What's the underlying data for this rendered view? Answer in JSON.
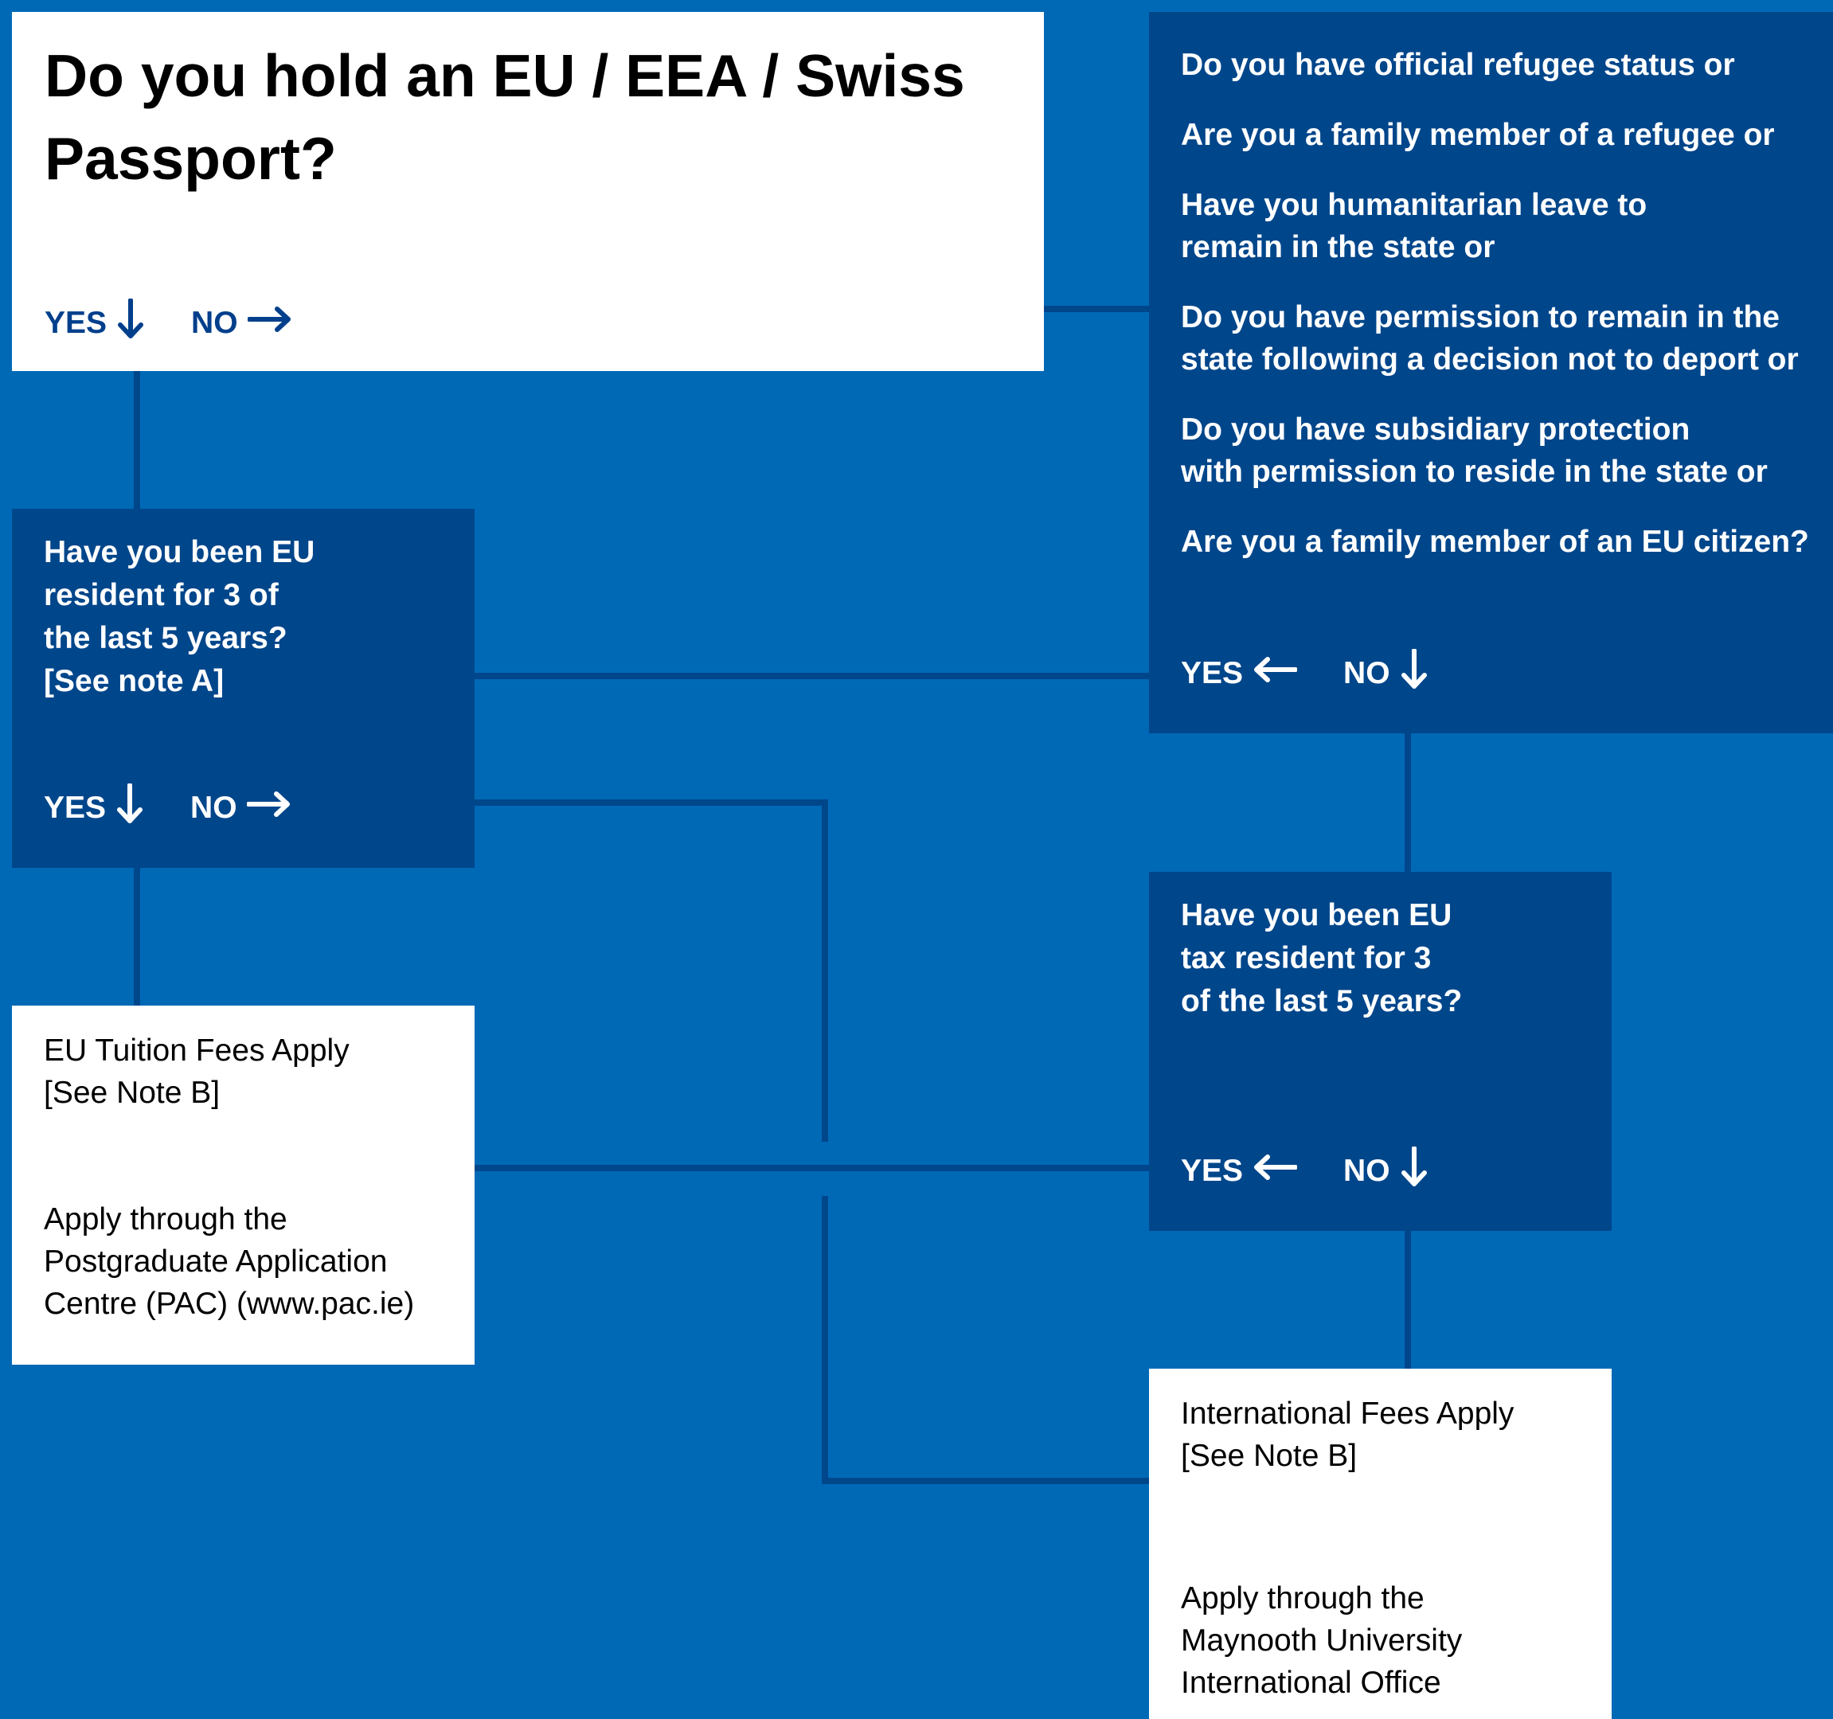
{
  "colors": {
    "background": "#0069B6",
    "dark_box": "#00468B",
    "white_box": "#FFFFFF",
    "connector": "#00468B",
    "yes_no_on_white": "#003F8C"
  },
  "q_passport": {
    "title": "Do you hold an EU / EEA / Swiss Passport?",
    "yes": "YES",
    "no": "NO",
    "yes_arrow": "arrow-down-icon",
    "no_arrow": "arrow-right-icon"
  },
  "q_status": {
    "items": [
      "Do you have official refugee status or",
      "Are you a family member of a refugee or",
      "Have you humanitarian leave to\nremain in the state or",
      "Do you have permission to remain in the\nstate following a decision not to deport or",
      "Do you have subsidiary protection\nwith permission to reside in the state or",
      "Are you a family member of an EU citizen?"
    ],
    "yes": "YES",
    "no": "NO",
    "yes_arrow": "arrow-left-icon",
    "no_arrow": "arrow-down-icon"
  },
  "q_resident": {
    "text": "Have you been EU\nresident for 3 of\nthe last 5 years?\n[See note A]",
    "yes": "YES",
    "no": "NO",
    "yes_arrow": "arrow-down-icon",
    "no_arrow": "arrow-right-icon"
  },
  "q_tax": {
    "text": "Have you been EU\ntax resident for 3\nof the last 5 years?",
    "yes": "YES",
    "no": "NO",
    "yes_arrow": "arrow-left-icon",
    "no_arrow": "arrow-down-icon"
  },
  "out_eu": {
    "heading": "EU Tuition Fees Apply\n[See Note B]",
    "body": "Apply through the\nPostgraduate Application\nCentre (PAC) (www.pac.ie)"
  },
  "out_intl": {
    "heading": "International Fees Apply\n[See Note B]",
    "body": "Apply through the\nMaynooth University\nInternational Office"
  }
}
